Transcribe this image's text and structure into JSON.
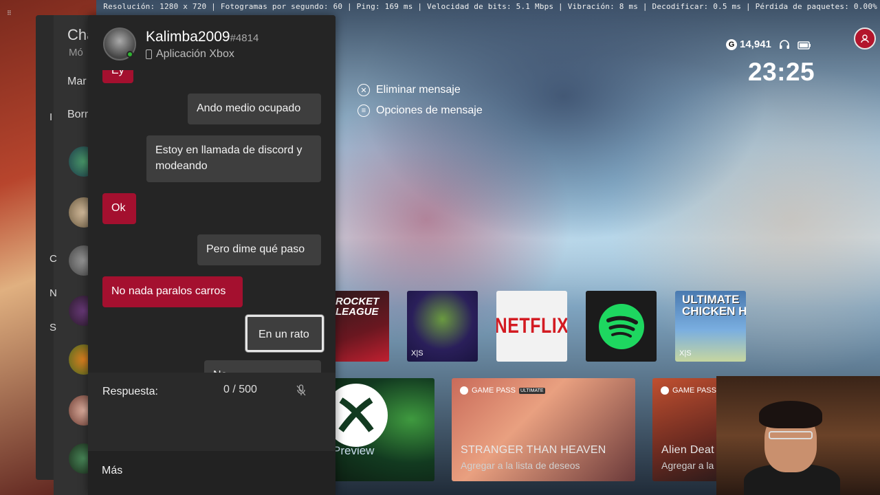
{
  "stats_bar": "Resolución: 1280 x 720 | Fotogramas por segundo: 60 | Ping: 169 ms | Velocidad de bits: 5.1 Mbps | Vibración: 8 ms | Decodificar: 0.5 ms | Pérdida de paquetes: 0.00%",
  "status": {
    "gamerscore_badge": "G",
    "gamerscore": "14,941",
    "time": "23:25"
  },
  "friends_panel": {
    "title_partial": "Cha",
    "subtitle_partial": "Mó",
    "item1_partial": "Mar",
    "item2_partial": "Borr",
    "letter_i": "I",
    "letter_c": "C",
    "letter_n": "N",
    "letter_s": "S"
  },
  "chat": {
    "username": "Kalimba2009",
    "tag": "#4814",
    "platform": "Aplicación Xbox",
    "messages": [
      {
        "text": "Ey",
        "dir": "in"
      },
      {
        "text": "Ando medio ocupado",
        "dir": "out"
      },
      {
        "text": "Estoy en llamada de discord y modeando",
        "dir": "out"
      },
      {
        "text": "Ok",
        "dir": "in"
      },
      {
        "text": "Pero dime qué paso",
        "dir": "out"
      },
      {
        "text": "No nada paralos carros",
        "dir": "in"
      },
      {
        "text": "En un rato",
        "dir": "out"
      },
      {
        "text": "No ...",
        "dir": "out"
      }
    ],
    "reply_label": "Respuesta:",
    "reply_count": "0 / 500",
    "more_label": "Más"
  },
  "message_options": {
    "delete_label": "Eliminar mensaje",
    "options_label": "Opciones de mensaje"
  },
  "tiles": {
    "rocket": "ROCKET\nLEAGUE",
    "netflix": "NETFLIX",
    "chicken": "ULTIMATE\nCHICKEN HORSE",
    "xs_badge": "X|S"
  },
  "cards": {
    "preview_title": "Preview",
    "gamepass_label": "GAME PASS",
    "ultimate_label": "ULTIMATE",
    "stranger_name": "STRANGER THAN HEAVEN",
    "stranger_sub": "Agregar a la lista de deseos",
    "alien_name": "Alien Deat",
    "alien_sub": "Agregar a la"
  },
  "colors": {
    "accent_red": "#a4102f",
    "panel_dark": "#252525",
    "online_green": "#2fb531"
  }
}
